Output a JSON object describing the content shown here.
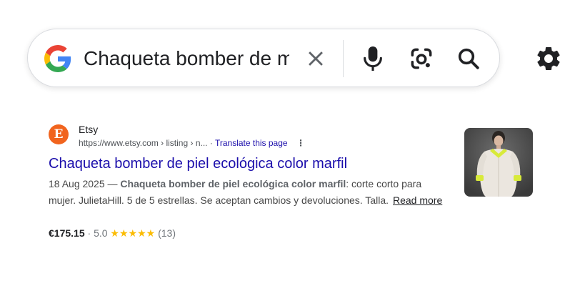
{
  "search": {
    "query": "Chaqueta bomber de m",
    "logo_icon": "google-g-icon",
    "clear_icon": "close-icon",
    "mic_icon": "microphone-icon",
    "lens_icon": "google-lens-icon",
    "search_icon": "search-icon"
  },
  "settings": {
    "icon": "gear-icon"
  },
  "result": {
    "favicon_letter": "E",
    "favicon_color": "#F1641E",
    "site_name": "Etsy",
    "url": "https://www.etsy.com › listing › n...",
    "separator": "·",
    "translate_label": "Translate this page",
    "more_icon": "vertical-dots-icon",
    "title": "Chaqueta bomber de piel ecológica color marfil",
    "date": "18 Aug 2025 —",
    "snippet_bold": "Chaqueta bomber de piel ecológica color marfil",
    "snippet_rest": ": corte corto para mujer. JulietaHill. 5 de 5 estrellas. Se aceptan cambios y devoluciones. Talla.",
    "read_more_label": "Read more",
    "price": "€175.15",
    "rating_sep": "·",
    "rating": "5.0",
    "stars": "★★★★★",
    "review_count": "(13)",
    "thumbnail_icon": "product-thumbnail"
  },
  "colors": {
    "link": "#1a0dab",
    "star": "#fbbc04",
    "etsy_orange": "#F1641E"
  }
}
